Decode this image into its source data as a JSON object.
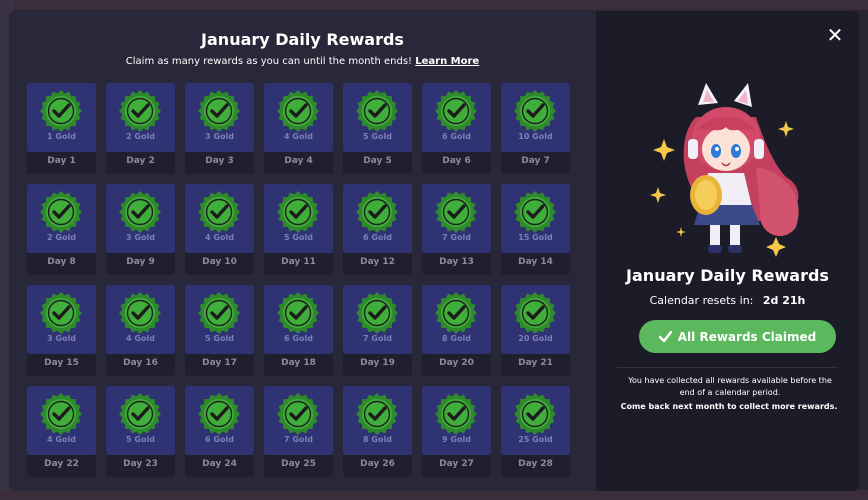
{
  "modal": {
    "title": "January Daily Rewards",
    "subtitle": "Claim as many rewards as you can until the month ends!",
    "learn_more": "Learn More",
    "close_glyph": "✕"
  },
  "rewards": [
    {
      "day": "Day 1",
      "reward": "1 Gold",
      "claimed": true
    },
    {
      "day": "Day 2",
      "reward": "2 Gold",
      "claimed": true
    },
    {
      "day": "Day 3",
      "reward": "3 Gold",
      "claimed": true
    },
    {
      "day": "Day 4",
      "reward": "4 Gold",
      "claimed": true
    },
    {
      "day": "Day 5",
      "reward": "5 Gold",
      "claimed": true
    },
    {
      "day": "Day 6",
      "reward": "6 Gold",
      "claimed": true
    },
    {
      "day": "Day 7",
      "reward": "10 Gold",
      "claimed": true
    },
    {
      "day": "Day 8",
      "reward": "2 Gold",
      "claimed": true
    },
    {
      "day": "Day 9",
      "reward": "3 Gold",
      "claimed": true
    },
    {
      "day": "Day 10",
      "reward": "4 Gold",
      "claimed": true
    },
    {
      "day": "Day 11",
      "reward": "5 Gold",
      "claimed": true
    },
    {
      "day": "Day 12",
      "reward": "6 Gold",
      "claimed": true
    },
    {
      "day": "Day 13",
      "reward": "7 Gold",
      "claimed": true
    },
    {
      "day": "Day 14",
      "reward": "15 Gold",
      "claimed": true
    },
    {
      "day": "Day 15",
      "reward": "3 Gold",
      "claimed": true
    },
    {
      "day": "Day 16",
      "reward": "4 Gold",
      "claimed": true
    },
    {
      "day": "Day 17",
      "reward": "5 Gold",
      "claimed": true
    },
    {
      "day": "Day 18",
      "reward": "6 Gold",
      "claimed": true
    },
    {
      "day": "Day 19",
      "reward": "7 Gold",
      "claimed": true
    },
    {
      "day": "Day 20",
      "reward": "8 Gold",
      "claimed": true
    },
    {
      "day": "Day 21",
      "reward": "20 Gold",
      "claimed": true
    },
    {
      "day": "Day 22",
      "reward": "4 Gold",
      "claimed": true
    },
    {
      "day": "Day 23",
      "reward": "5 Gold",
      "claimed": true
    },
    {
      "day": "Day 24",
      "reward": "6 Gold",
      "claimed": true
    },
    {
      "day": "Day 25",
      "reward": "7 Gold",
      "claimed": true
    },
    {
      "day": "Day 26",
      "reward": "8 Gold",
      "claimed": true
    },
    {
      "day": "Day 27",
      "reward": "9 Gold",
      "claimed": true
    },
    {
      "day": "Day 28",
      "reward": "25 Gold",
      "claimed": true
    }
  ],
  "sidebar": {
    "title": "January Daily Rewards",
    "reset_label": "Calendar resets in:",
    "reset_value": "2d 21h",
    "claim_button": "All Rewards Claimed",
    "note": "You have collected all rewards available before the end of a calendar period.",
    "note_bold": "Come back next month to collect more rewards."
  },
  "icons": {
    "badge": "check-badge-icon",
    "close": "close-icon",
    "button": "checkmark-icon",
    "mascot": "catgirl-mascot-illustration"
  },
  "colors": {
    "badge_green": "#3fae3a",
    "badge_ring": "#2f8a2b",
    "tile_blue": "#2f3273",
    "button_green": "#5cb85c",
    "modal_left": "#28283a",
    "modal_right": "#1c1b28"
  }
}
